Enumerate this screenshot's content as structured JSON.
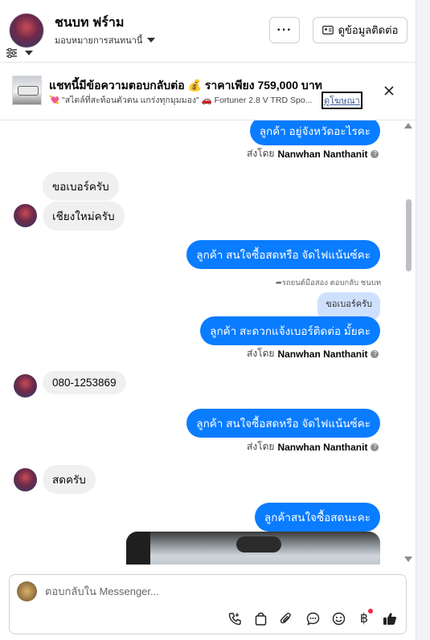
{
  "header": {
    "name": "ชนบท ฟร์าม",
    "assign_label": "มอบหมายการสนทนานี้",
    "more_label": "···",
    "contact_button": "ดูข้อมูลติดต่อ"
  },
  "ad_banner": {
    "title": "แชทนี้มีข้อความตอบกลับต่อ 💰 ราคาเพียง 759,000 บาท",
    "description": "💘 \"สไตล์ที่สะท้อนตัวตน แกร่งทุกมุมมอง\" 🚗 Fortuner 2.8 V TRD Spo...",
    "link_label": "ดูโฆษณา"
  },
  "messages": [
    {
      "text": "ลูกค้า อยู่จังหวัดอะไรคะ"
    },
    {
      "text": "ขอเบอร์ครับ"
    },
    {
      "text": "เชียงใหม่ครับ"
    },
    {
      "text": "ลูกค้า สนใจซื้อสดหรือ จัดไฟแน้นซ์คะ"
    },
    {
      "reply_note": "รถยนต์มือสอง ตอบกลับ ชนบท",
      "quoted": "ขอเบอร์ครับ",
      "text": "ลูกค้า สะดวกแจ้งเบอร์ติดต่อ มั้ยคะ"
    },
    {
      "text": "080-1253869"
    },
    {
      "text": "ลูกค้า สนใจซื้อสดหรือ จัดไฟแน้นซ์คะ"
    },
    {
      "text": "สดครับ"
    },
    {
      "text": "ลูกค้าสนใจซื้อสดนะคะ"
    }
  ],
  "sent_by": {
    "prefix": "ส่งโดย",
    "agent": "Nanwhan Nanthanit"
  },
  "composer": {
    "placeholder": "ตอบกลับใน Messenger..."
  },
  "colors": {
    "outgoing_bubble": "#0a7cff",
    "incoming_bubble": "#f0f0f0",
    "notification_dot": "#f02849"
  },
  "icons": [
    "filter-icon",
    "contact-card-icon",
    "close-icon",
    "call-icon",
    "bag-icon",
    "attachment-icon",
    "chat-bubble-icon",
    "emoji-icon",
    "baht-icon",
    "thumbs-up-icon"
  ]
}
